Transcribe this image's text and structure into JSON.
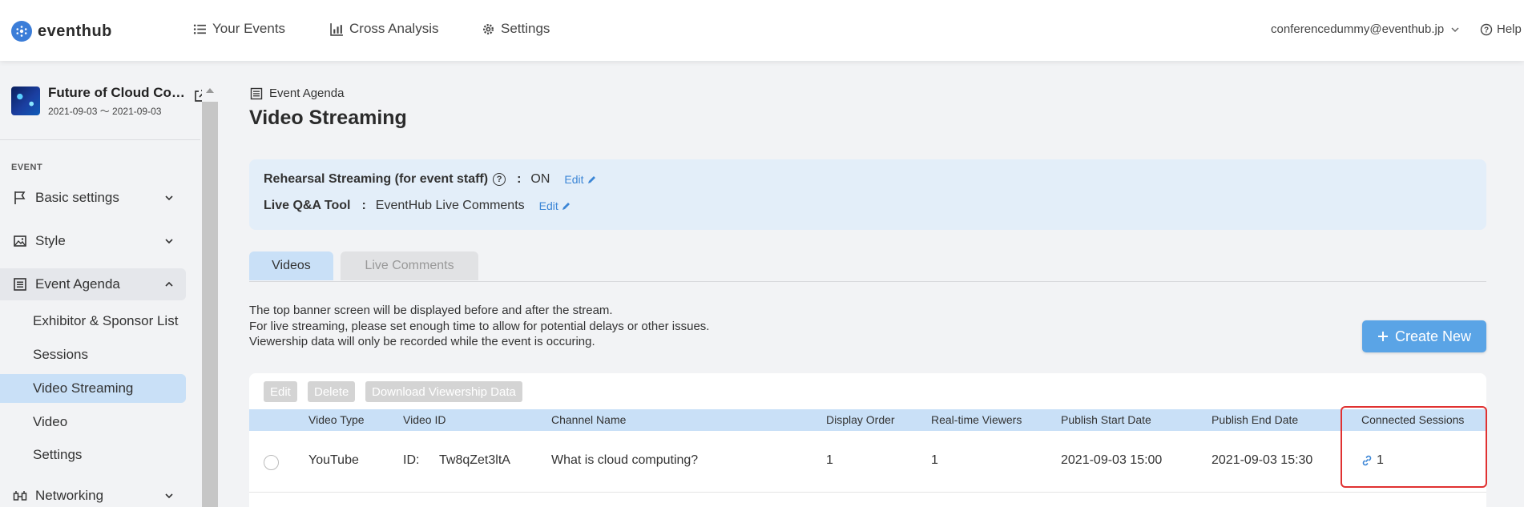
{
  "brand": {
    "name": "eventhub",
    "accent": "#3b7dd8"
  },
  "nav": {
    "your_events": "Your Events",
    "cross_analysis": "Cross Analysis",
    "settings": "Settings",
    "user_email": "conferencedummy@eventhub.jp",
    "help": "Help"
  },
  "event": {
    "title": "Future of Cloud Computing",
    "dates": "2021-09-03 ～ 2021-09-03"
  },
  "sidebar": {
    "section": "EVENT",
    "basic_settings": "Basic settings",
    "style": "Style",
    "event_agenda": "Event Agenda",
    "sub": [
      "Exhibitor & Sponsor List",
      "Sessions",
      "Video Streaming",
      "Video",
      "Settings"
    ],
    "networking": "Networking"
  },
  "page": {
    "breadcrumb": "Event Agenda",
    "title": "Video Streaming"
  },
  "info": {
    "rehearsal_label": "Rehearsal Streaming (for event staff)",
    "rehearsal_value": "ON",
    "qa_label": "Live Q&A Tool",
    "qa_value": "EventHub Live Comments",
    "colon": ":",
    "edit": "Edit",
    "help_glyph": "?"
  },
  "tabs": {
    "videos": "Videos",
    "live_comments": "Live Comments"
  },
  "notes": [
    "The top banner screen will be displayed before and after the stream.",
    "For live streaming, please set enough time to allow for potential delays or other issues.",
    "Viewership data will only be recorded while the event is occuring."
  ],
  "create_button": "Create New",
  "table_actions": {
    "edit": "Edit",
    "delete": "Delete",
    "download": "Download Viewership Data"
  },
  "columns": {
    "video_type": "Video Type",
    "video_id": "Video ID",
    "channel_name": "Channel Name",
    "display_order": "Display Order",
    "realtime_viewers": "Real-time Viewers",
    "publish_start": "Publish Start Date",
    "publish_end": "Publish End Date",
    "connected_sessions": "Connected Sessions"
  },
  "rows": [
    {
      "video_type": "YouTube",
      "id_prefix": "ID:",
      "video_id": "Tw8qZet3ltA",
      "channel_name": "What is cloud computing?",
      "display_order": "1",
      "realtime_viewers": "1",
      "publish_start": "2021-09-03 15:00",
      "publish_end": "2021-09-03 15:30",
      "connected_sessions": "1"
    }
  ]
}
